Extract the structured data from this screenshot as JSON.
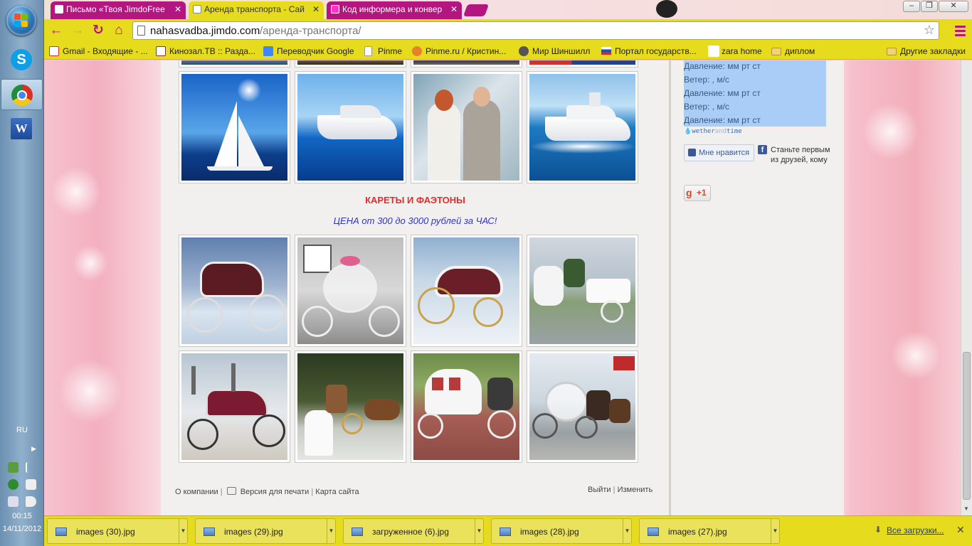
{
  "taskbar": {
    "language": "RU",
    "clock_time": "00:15",
    "clock_date": "14/11/2012",
    "skype_glyph": "S",
    "word_glyph": "W"
  },
  "tabs": [
    {
      "title": "Письмо «Твоя JimdoFree",
      "active": false
    },
    {
      "title": "Аренда транспорта - Сай",
      "active": true
    },
    {
      "title": "Код информера и конвер",
      "active": false
    }
  ],
  "address": {
    "host": "nahasvadba.jimdo.com",
    "path": "/аренда-транспорта/"
  },
  "bookmarks": [
    {
      "label": "Gmail - Входящие - ...",
      "icon": "gmail-icon",
      "color": "#d93025"
    },
    {
      "label": "Кинозал.ТВ :: Разда...",
      "icon": "kinozal-icon",
      "color": "#8a2b2b"
    },
    {
      "label": "Переводчик Google",
      "icon": "translate-icon",
      "color": "#4285f4"
    },
    {
      "label": "Pinme",
      "icon": "page-icon",
      "color": "#ffffff"
    },
    {
      "label": "Pinme.ru / Кристин...",
      "icon": "pin-icon",
      "color": "#e8822a"
    },
    {
      "label": "Мир Шиншилл",
      "icon": "chinchilla-icon",
      "color": "#555555"
    },
    {
      "label": "Портал государств...",
      "icon": "russia-flag-icon",
      "color": "#1f4fb3"
    },
    {
      "label": "zara home",
      "icon": "page-icon",
      "color": "#ffffff"
    },
    {
      "label": "диплом",
      "icon": "folder-icon",
      "color": "#e8c25a"
    }
  ],
  "other_bookmarks": "Другие закладки",
  "content": {
    "section_title": "КАРЕТЫ И ФАЭТОНЫ",
    "price": "ЦЕНА от 300 до 3000 рублей за ЧАС!",
    "footer": {
      "about": "О компании",
      "print": "Версия для печати",
      "sitemap": "Карта сайта",
      "logout": "Выйти",
      "edit": "Изменить",
      "separator": "|"
    }
  },
  "sidebar": {
    "weather_lines": [
      "Давление:  мм рт ст",
      "Ветер: , м/с",
      "Давление:  мм рт ст",
      "Ветер: , м/с",
      "Давление:  мм рт ст"
    ],
    "weather_brand_a": "wether",
    "weather_brand_b": "and",
    "weather_brand_c": "time",
    "like_label": "Мне нравится",
    "fb_text": "Станьте первым из друзей, кому",
    "gplus_g": "g",
    "gplus_label": "+1"
  },
  "downloads": [
    {
      "name": "images (30).jpg"
    },
    {
      "name": "images (29).jpg"
    },
    {
      "name": "загруженное (6).jpg"
    },
    {
      "name": "images (28).jpg"
    },
    {
      "name": "images (27).jpg"
    }
  ],
  "all_downloads": "Все загрузки...",
  "colors": {
    "accent_magenta": "#b3167e",
    "chrome_yellow": "#e6db1c",
    "title_red": "#e32b2b",
    "price_blue": "#2f35c8",
    "weather_bg": "#a9cdf7"
  }
}
